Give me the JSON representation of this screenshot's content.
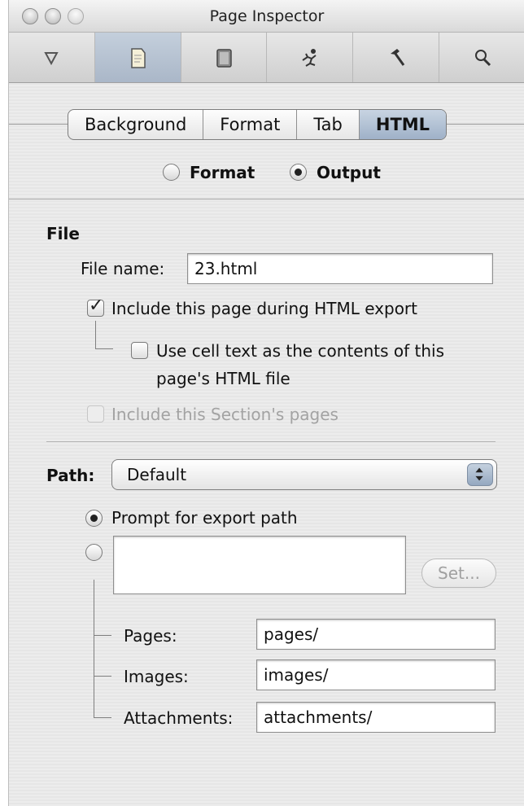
{
  "window": {
    "title": "Page Inspector"
  },
  "toolbar": {
    "items": [
      {
        "icon": "disclosure-triangle-icon",
        "selected": false
      },
      {
        "icon": "page-icon",
        "selected": true
      },
      {
        "icon": "notebook-icon",
        "selected": false
      },
      {
        "icon": "running-figure-icon",
        "selected": false
      },
      {
        "icon": "hammer-icon",
        "selected": false
      },
      {
        "icon": "magnifier-icon",
        "selected": false
      }
    ]
  },
  "tabs": [
    {
      "label": "Background",
      "active": false
    },
    {
      "label": "Format",
      "active": false
    },
    {
      "label": "Tab",
      "active": false
    },
    {
      "label": "HTML",
      "active": true
    }
  ],
  "mode": {
    "format_label": "Format",
    "output_label": "Output",
    "selected": "Output"
  },
  "file": {
    "section_title": "File",
    "filename_label": "File name:",
    "filename_value": "23.html",
    "include_page_label": "Include this page during HTML export",
    "include_page_checked": true,
    "use_cell_text_label_line1": "Use cell text as the contents of this",
    "use_cell_text_label_line2": "page's HTML file",
    "use_cell_text_checked": false,
    "include_section_label": "Include this Section's pages",
    "include_section_checked": false
  },
  "path": {
    "label": "Path:",
    "selected": "Default",
    "prompt_label": "Prompt for export path",
    "prompt_selected": true,
    "custom_path_value": "",
    "set_button_label": "Set...",
    "pages_label": "Pages:",
    "pages_value": "pages/",
    "images_label": "Images:",
    "images_value": "images/",
    "attachments_label": "Attachments:",
    "attachments_value": "attachments/"
  }
}
